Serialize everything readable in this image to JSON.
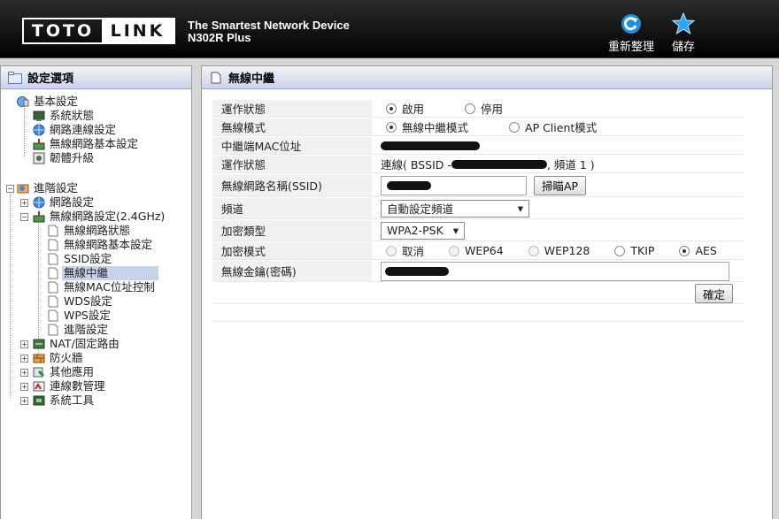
{
  "header": {
    "logo_left": "TOTO",
    "logo_right": "LINK",
    "tagline": "The Smartest Network Device",
    "model": "N302R Plus",
    "refresh_label": "重新整理",
    "save_label": "儲存"
  },
  "sidebar": {
    "title": "設定選項",
    "basic": {
      "label": "基本設定",
      "items": [
        "系統狀態",
        "網路連線設定",
        "無線網路基本設定",
        "韌體升級"
      ]
    },
    "advanced": {
      "label": "進階設定",
      "network": "網路設定",
      "wireless": "無線網路設定(2.4GHz)",
      "wireless_items": [
        "無線網路狀態",
        "無線網路基本設定",
        "SSID設定",
        "無線中繼",
        "無線MAC位址控制",
        "WDS設定",
        "WPS設定",
        "進階設定"
      ],
      "others": [
        "NAT/固定路由",
        "防火牆",
        "其他應用",
        "連線數管理",
        "系統工具"
      ]
    }
  },
  "main": {
    "title": "無線中繼",
    "rows": {
      "op_status": {
        "label": "運作狀態",
        "enable": "啟用",
        "disable": "停用"
      },
      "wireless_mode": {
        "label": "無線模式",
        "repeater": "無線中繼模式",
        "ap_client": "AP Client模式"
      },
      "repeater_mac": {
        "label": "中繼端MAC位址"
      },
      "run_status": {
        "label": "運作狀態",
        "prefix": "連線( BSSID - ",
        "suffix": " , 頻道 1 )"
      },
      "ssid": {
        "label": "無線網路名稱(SSID)",
        "scan_button": "掃瞄AP"
      },
      "channel": {
        "label": "頻道",
        "value": "自動設定頻道"
      },
      "enc_type": {
        "label": "加密類型",
        "value": "WPA2-PSK"
      },
      "enc_mode": {
        "label": "加密模式",
        "options": [
          "取消",
          "WEP64",
          "WEP128",
          "TKIP",
          "AES"
        ]
      },
      "key": {
        "label": "無線金鑰(密碼)"
      }
    },
    "apply_button": "確定"
  }
}
